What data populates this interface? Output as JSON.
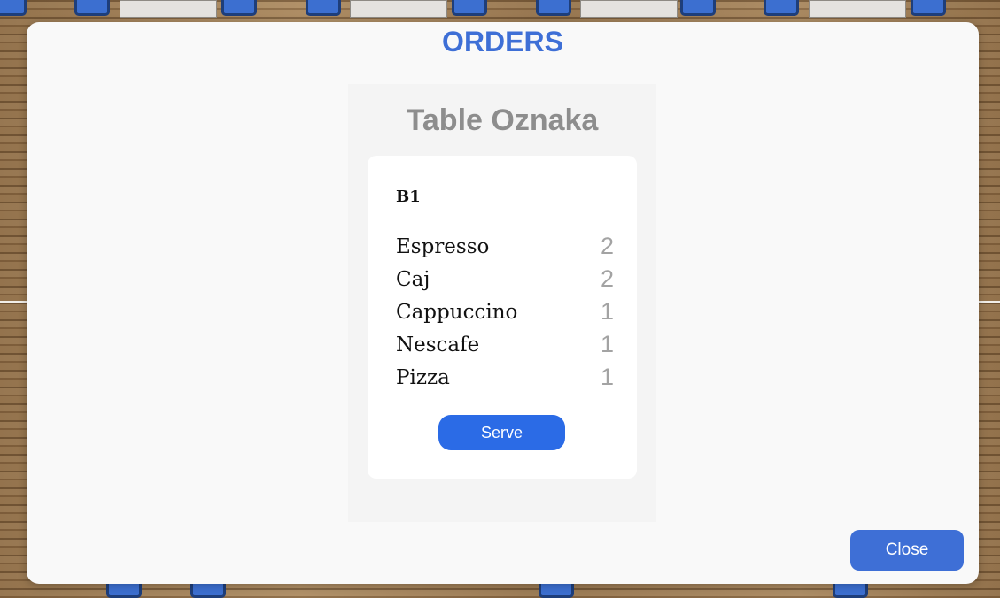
{
  "modal": {
    "title": "ORDERS",
    "close_label": "Close"
  },
  "table": {
    "name": "Table Oznaka"
  },
  "order": {
    "id": "B1",
    "items": [
      {
        "name": "Espresso",
        "qty": "2"
      },
      {
        "name": "Caj",
        "qty": "2"
      },
      {
        "name": "Cappuccino",
        "qty": "1"
      },
      {
        "name": "Nescafe",
        "qty": "1"
      },
      {
        "name": "Pizza",
        "qty": "1"
      }
    ],
    "serve_label": "Serve"
  },
  "colors": {
    "accent": "#3e6fd6",
    "serve_button": "#2b6be6",
    "chair": "#3c6fd0"
  }
}
